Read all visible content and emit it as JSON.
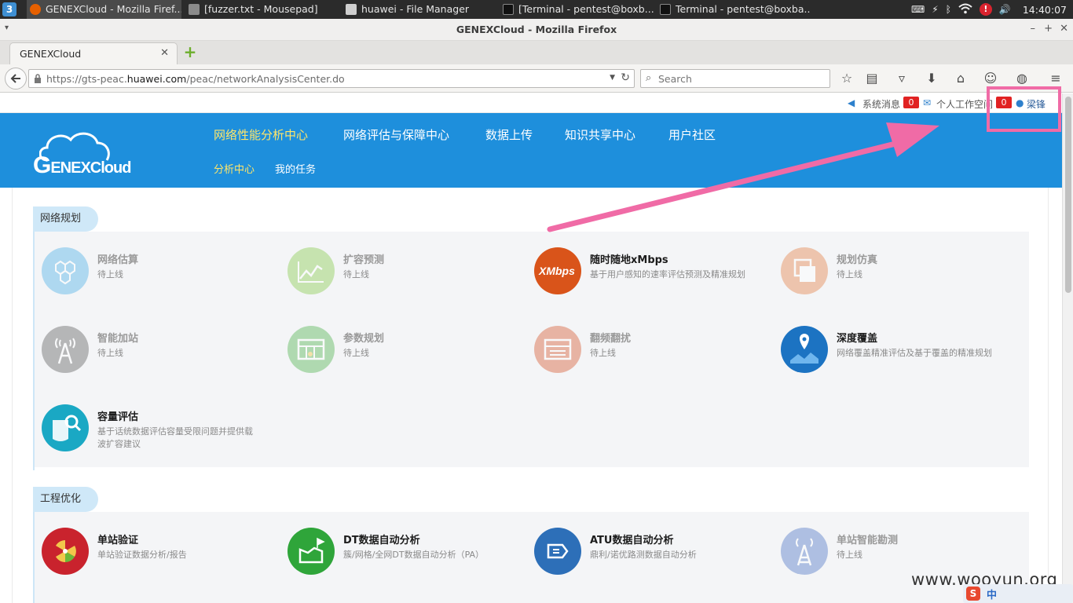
{
  "taskbar": {
    "start_label": "3",
    "tasks": [
      {
        "label": "GENEXCloud - Mozilla Firef...",
        "active": true,
        "color": "#e66000"
      },
      {
        "label": "[fuzzer.txt - Mousepad]",
        "active": false,
        "color": "#8b8b8b"
      },
      {
        "label": "huawei - File Manager",
        "active": false,
        "color": "#cfcfcf"
      },
      {
        "label": "[Terminal - pentest@boxb...",
        "active": false,
        "color": "#222222"
      },
      {
        "label": "Terminal - pentest@boxba...",
        "active": false,
        "color": "#222222"
      }
    ],
    "tray": {
      "alert": "!",
      "clock": "14:40:07"
    }
  },
  "window": {
    "title": "GENEXCloud - Mozilla Firefox"
  },
  "browser": {
    "tab_title": "GENEXCloud",
    "url_prefix": "https://gts-peac.",
    "url_domain": "huawei.com",
    "url_path": "/peac/networkAnalysisCenter.do",
    "search_placeholder": "Search"
  },
  "topbar": {
    "messages_label": "系统消息",
    "messages_count": "0",
    "workspace_label": "个人工作空间",
    "workspace_count": "0",
    "user_name": "梁锋"
  },
  "header": {
    "logo_big": "G",
    "logo_rest": "ENEXCloud",
    "nav": [
      {
        "label": "网络性能分析中心",
        "active": true
      },
      {
        "label": "网络评估与保障中心",
        "active": false
      },
      {
        "label": "数据上传",
        "active": false
      },
      {
        "label": "知识共享中心",
        "active": false
      },
      {
        "label": "用户社区",
        "active": false
      }
    ],
    "subnav": [
      {
        "label": "分析中心",
        "active": true
      },
      {
        "label": "我的任务",
        "active": false
      }
    ]
  },
  "sections": [
    {
      "title": "网络规划",
      "cards": [
        {
          "name": "网络估算",
          "desc": "待上线",
          "icon": "hexagon-network-icon",
          "color": "#5bb6e8",
          "dim": true
        },
        {
          "name": "扩容预测",
          "desc": "待上线",
          "icon": "line-trend-icon",
          "color": "#8fcf5a",
          "dim": true
        },
        {
          "name": "随时随地xMbps",
          "desc": "基于用户感知的速率评估预测及精准规划",
          "icon": "xmbps-icon",
          "color": "#d9541a",
          "dim": false
        },
        {
          "name": "规划仿真",
          "desc": "待上线",
          "icon": "layers-icon",
          "color": "#e58a55",
          "dim": true
        },
        {
          "name": "智能加站",
          "desc": "待上线",
          "icon": "antenna-tower-icon",
          "color": "#6b6b6b",
          "dim": true
        },
        {
          "name": "参数规划",
          "desc": "待上线",
          "icon": "parameter-grid-icon",
          "color": "#5cb85c",
          "dim": true
        },
        {
          "name": "翻频翻扰",
          "desc": "待上线",
          "icon": "frequency-table-icon",
          "color": "#d9653f",
          "dim": true
        },
        {
          "name": "深度覆盖",
          "desc": "网络覆盖精准评估及基于覆盖的精准规划",
          "icon": "map-pin-icon",
          "color": "#1c73c2",
          "dim": false
        },
        {
          "name": "容量评估",
          "desc": "基于话统数据评估容量受限问题并提供载波扩容建议",
          "icon": "capacity-search-icon",
          "color": "#1aa8c4",
          "dim": false
        }
      ]
    },
    {
      "title": "工程优化",
      "cards": [
        {
          "name": "单站验证",
          "desc": "单站验证数据分析/报告",
          "icon": "radiation-icon",
          "color": "#c9232d",
          "dim": false
        },
        {
          "name": "DT数据自动分析",
          "desc": "簇/网格/全网DT数据自动分析（PA）",
          "icon": "dt-flag-icon",
          "color": "#2fa53a",
          "dim": false
        },
        {
          "name": "ATU数据自动分析",
          "desc": "鼎利/诺优路测数据自动分析",
          "icon": "atu-plug-icon",
          "color": "#2d6fb8",
          "dim": false
        },
        {
          "name": "单站智能勘测",
          "desc": "待上线",
          "icon": "survey-tower-icon",
          "color": "#5a7fc9",
          "dim": true
        }
      ]
    }
  ],
  "overlay": {
    "watermark": "www.wooyun.org",
    "ime_s": "S",
    "ime_mode": "中"
  },
  "colors": {
    "brand_blue": "#1e8fdc",
    "nav_active": "#ffe66a",
    "annotation_pink": "#f06ba6",
    "badge_red": "#e12222"
  }
}
